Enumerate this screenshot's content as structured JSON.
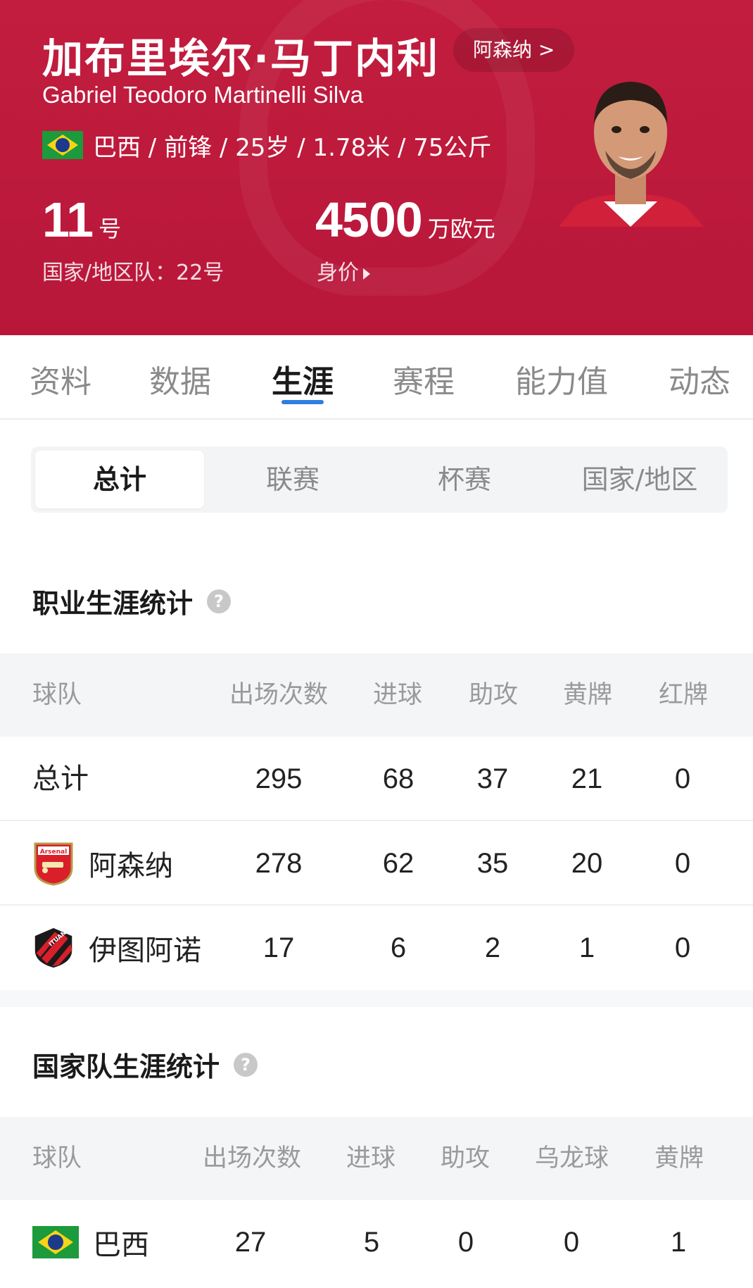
{
  "player": {
    "name_cn": "加布里埃尔·马丁内利",
    "name_en": "Gabriel Teodoro Martinelli Silva",
    "club_chip": "阿森纳 >",
    "info": "巴西 / 前锋 / 25岁 / 1.78米 / 75公斤",
    "shirt_number": "11",
    "shirt_unit": "号",
    "national_number": "国家/地区队：22号",
    "market_value": "4500",
    "market_value_unit": "万欧元",
    "market_value_label": "身价",
    "colors": {
      "header": "#c21d3e",
      "accent": "#2e7de0"
    }
  },
  "tabs": [
    {
      "label": "资料",
      "active": false
    },
    {
      "label": "数据",
      "active": false
    },
    {
      "label": "生涯",
      "active": true
    },
    {
      "label": "赛程",
      "active": false
    },
    {
      "label": "能力值",
      "active": false
    },
    {
      "label": "动态",
      "active": false
    }
  ],
  "segments": [
    "总计",
    "联赛",
    "杯赛",
    "国家/地区"
  ],
  "career": {
    "title": "职业生涯统计",
    "help": "?",
    "headers": [
      "球队",
      "出场次数",
      "进球",
      "助攻",
      "黄牌",
      "红牌"
    ],
    "rows": [
      {
        "team": "总计",
        "apps": "295",
        "goals": "68",
        "assists": "37",
        "yellow": "21",
        "red": "0"
      },
      {
        "team": "阿森纳",
        "apps": "278",
        "goals": "62",
        "assists": "35",
        "yellow": "20",
        "red": "0"
      },
      {
        "team": "伊图阿诺",
        "apps": "17",
        "goals": "6",
        "assists": "2",
        "yellow": "1",
        "red": "0"
      }
    ],
    "crests": {
      "arsenal_text": "Arsenal",
      "ituano_text": "ITUANO"
    }
  },
  "national": {
    "title": "国家队生涯统计",
    "help": "?",
    "headers": [
      "球队",
      "出场次数",
      "进球",
      "助攻",
      "乌龙球",
      "黄牌"
    ],
    "rows": [
      {
        "team": "巴西",
        "apps": "27",
        "goals": "5",
        "assists": "0",
        "own_goals": "0",
        "yellow": "1"
      }
    ]
  }
}
